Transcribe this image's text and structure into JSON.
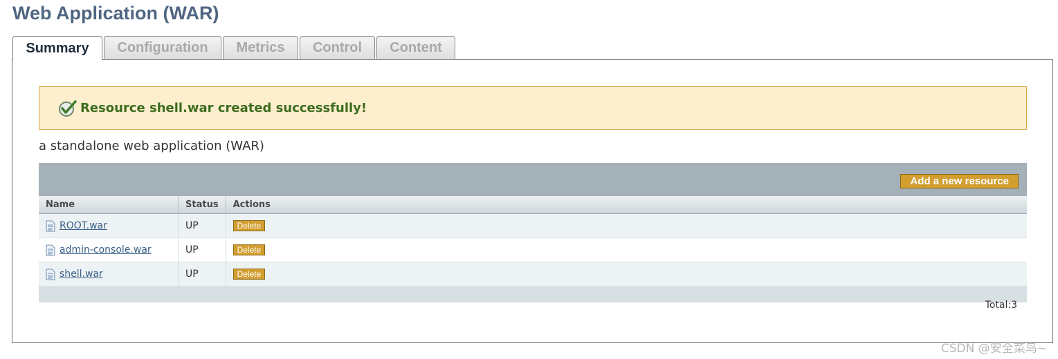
{
  "page": {
    "title": "Web Application (WAR)"
  },
  "tabs": [
    {
      "label": "Summary",
      "active": true
    },
    {
      "label": "Configuration",
      "active": false
    },
    {
      "label": "Metrics",
      "active": false
    },
    {
      "label": "Control",
      "active": false
    },
    {
      "label": "Content",
      "active": false
    }
  ],
  "alert": {
    "icon": "check-circle-icon",
    "message": "Resource shell.war created successfully!"
  },
  "description": "a standalone web application (WAR)",
  "table": {
    "add_button": "Add a new resource",
    "columns": [
      "Name",
      "Status",
      "Actions"
    ],
    "rows": [
      {
        "name": "ROOT.war",
        "status": "UP",
        "action": "Delete"
      },
      {
        "name": "admin-console.war",
        "status": "UP",
        "action": "Delete"
      },
      {
        "name": "shell.war",
        "status": "UP",
        "action": "Delete"
      }
    ],
    "total": "Total:3"
  },
  "watermark": "CSDN @安全菜鸟~",
  "colors": {
    "accent": "#d29e2f",
    "title": "#4f6582",
    "success": "#3c6c1e"
  }
}
